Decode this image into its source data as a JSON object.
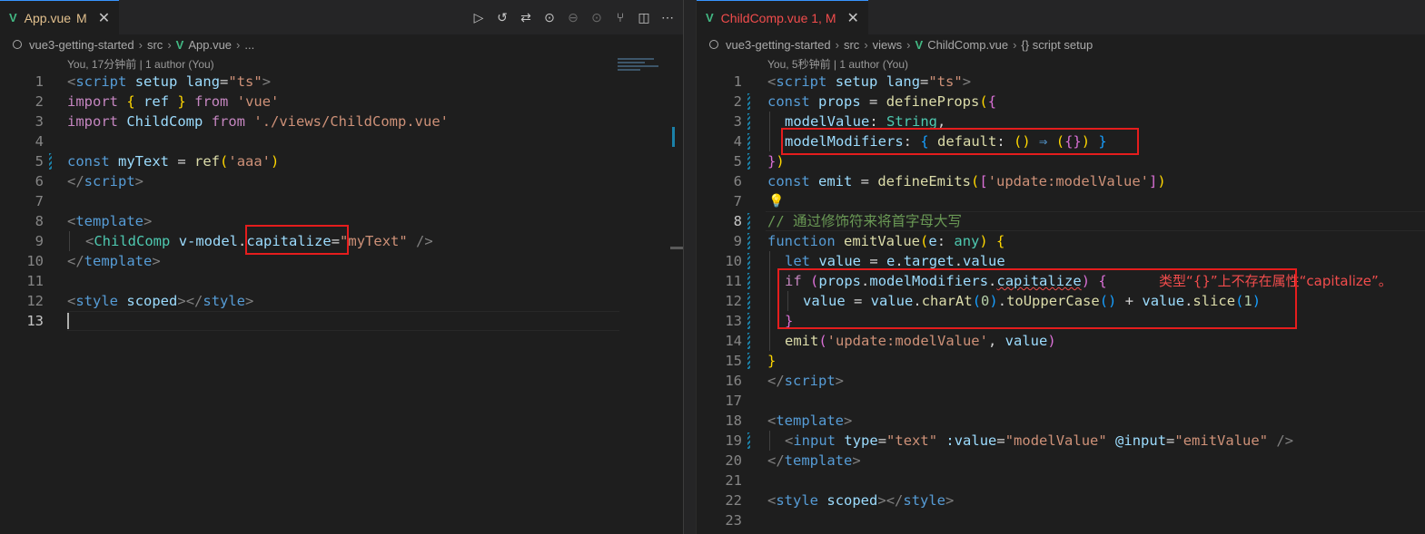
{
  "left": {
    "tab": {
      "label": "App.vue",
      "modified": "M",
      "close": "✕",
      "icon": "V"
    },
    "toolbar": [
      "run-icon",
      "history-icon",
      "git-compare-icon",
      "go-back-icon",
      "commit-icon",
      "go-forward-icon",
      "git-graph-icon",
      "split-editor-icon",
      "more-icon"
    ],
    "breadcrumb": {
      "root": "vue3-getting-started",
      "dir": "src",
      "file": "App.vue",
      "more": "..."
    },
    "blame": "You, 17分钟前 | 1 author (You)",
    "lines": [
      "1",
      "2",
      "3",
      "4",
      "5",
      "6",
      "7",
      "8",
      "9",
      "10",
      "11",
      "12",
      "13"
    ]
  },
  "right": {
    "tab": {
      "label": "ChildComp.vue 1, M",
      "close": "✕",
      "icon": "V"
    },
    "breadcrumb": {
      "root": "vue3-getting-started",
      "dir1": "src",
      "dir2": "views",
      "file": "ChildComp.vue",
      "symbol": "{} script setup"
    },
    "blame": "You, 5秒钟前 | 1 author (You)",
    "lines": [
      "1",
      "2",
      "3",
      "4",
      "5",
      "6",
      "7",
      "8",
      "9",
      "10",
      "11",
      "12",
      "13",
      "14",
      "15",
      "16",
      "17",
      "18",
      "19",
      "20",
      "21",
      "22",
      "23"
    ],
    "comment": "// 通过修饰符来将首字母大写",
    "error": "类型“{}”上不存在属性“capitalize”。"
  },
  "colors": {
    "editor_bg": "#1e1e1e",
    "tab_bar": "#252526",
    "highlight_box": "#e51d1d",
    "error": "#f14c4c",
    "vue_green": "#42b883"
  }
}
